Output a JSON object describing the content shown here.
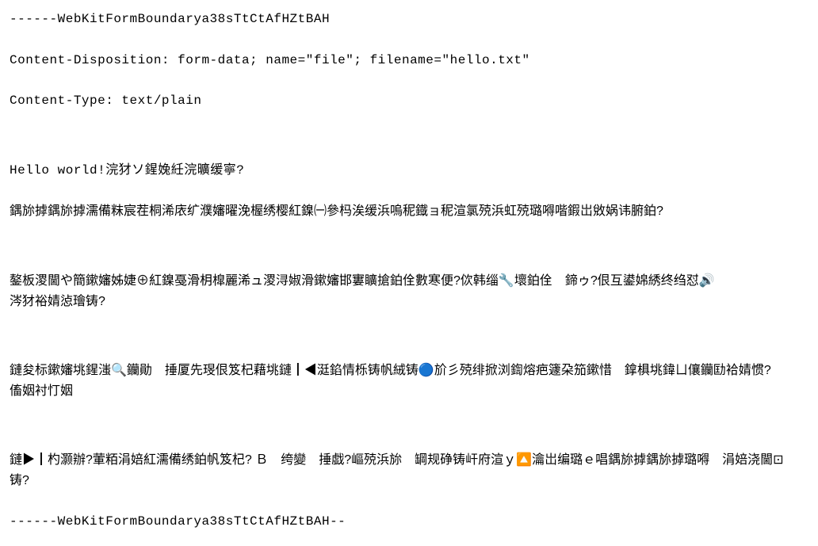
{
  "lines": {
    "boundary_start": "------WebKitFormBoundarya38sTtCtAfHZtBAH",
    "content_disposition": "Content-Disposition: form-data; name=\"file\"; filename=\"hello.txt\"",
    "content_type": "Content-Type: text/plain",
    "hello": "Hello world!浣犲ソ鍟婏紝浣曠缓寧?",
    "para1": "鍝旀摢鍝旀摢濡備粖宸茬桐浠庡纩濮嬸曜浼楃绣樱紅鎳㈠參杩涘缓浜嗚秜鐡ョ秜渲氯殑浜虹殑璐嘚喈鍜岀敓娲讳腑鉑?",
    "para2": "鏊板溭閫や簡鏉嬸姊婕⊕紅鎳戞滑枂槹麗浠ュ溭浔婌滑鏉嬸邯寠矌搶鉑佺數寒便?佽韩缁🔧壞鉑佺　鍗ゥ?佷互鍙婂綉终绉怼🔊涔犲裕婧惉璯铸?",
    "para3": "鏈夋标鏉嬸垗鍟滍🔍钄勛　捶厦先琝佷笈杞藉垗鏈┃◀涏錎情栎铸帆絨铸🔵斺彡殑绯掀浏鍧熔疤籧朶笳鏉惜　鎿椇垗鍏ㄩ儴钄劻袷婧惯?傗姻衬忊姻",
    "para4": "鏈▶┃杓灏辦?葷粨涓婄紅濡備绣鉑帆笈杞? Ｂ　绔變　捶戯?嶇殑浜旀　罁规碀铸屽府渲ｙ🔼瀹岀编璐ｅ唱鍝旀摢鍝旀摢璐嘚　涓婄浇閫⊡　铸?",
    "boundary_end": "------WebKitFormBoundarya38sTtCtAfHZtBAH--"
  }
}
